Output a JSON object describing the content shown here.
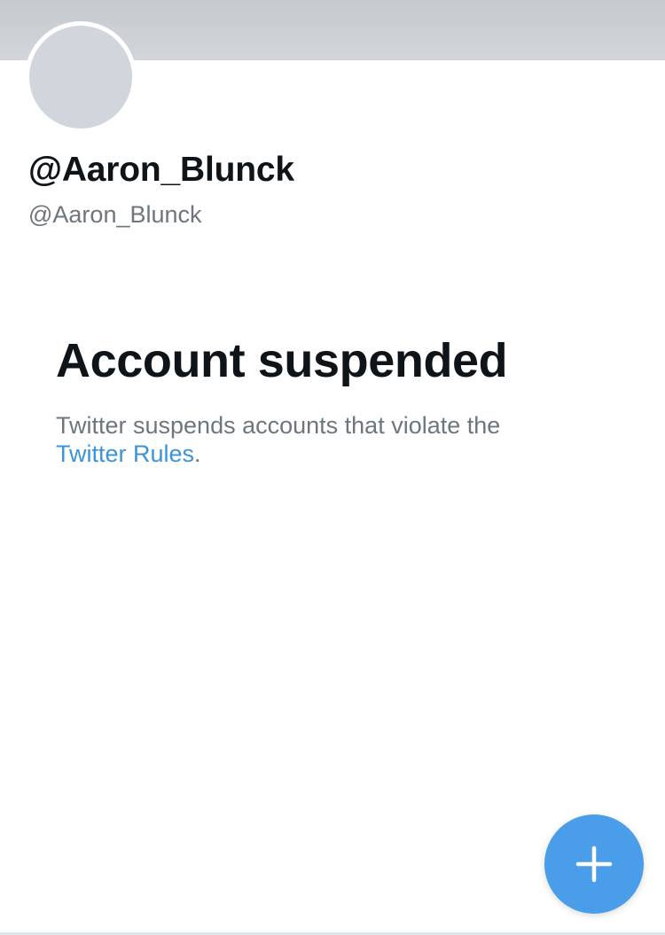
{
  "profile": {
    "display_name": "@Aaron_Blunck",
    "handle": "@Aaron_Blunck"
  },
  "notice": {
    "title": "Account suspended",
    "body_prefix": "Twitter suspends accounts that violate the",
    "link_text": "Twitter Rules",
    "body_suffix": "."
  },
  "fab": {
    "icon": "plus-icon"
  },
  "colors": {
    "link": "#3b94d9",
    "fab": "#4a9de8",
    "banner": "#c5cacf"
  }
}
